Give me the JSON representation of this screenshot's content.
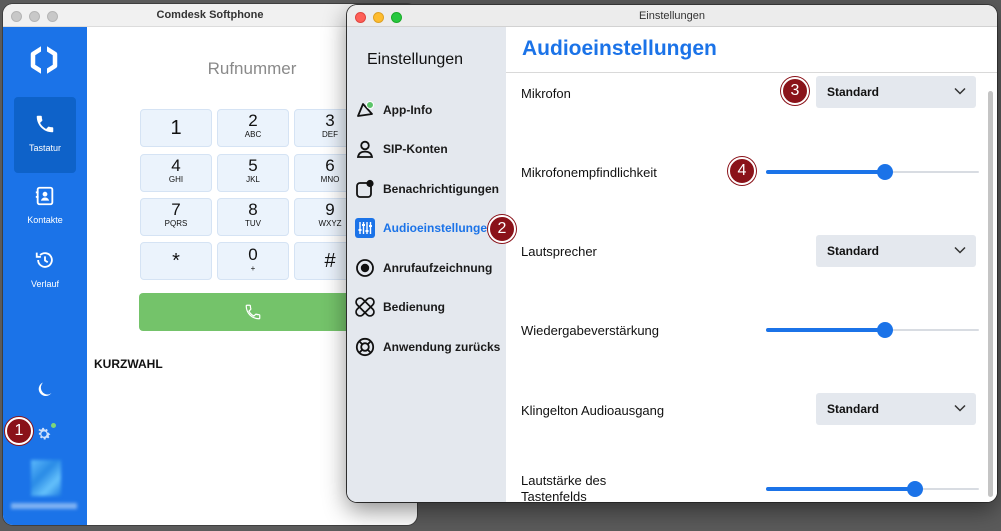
{
  "softphone": {
    "window_title": "Comdesk Softphone",
    "nav": [
      {
        "label": "Tastatur",
        "icon": "phone-icon"
      },
      {
        "label": "Kontakte",
        "icon": "contacts-icon"
      },
      {
        "label": "Verlauf",
        "icon": "history-icon"
      }
    ],
    "dial_title": "Rufnummer",
    "keys": [
      {
        "digit": "1",
        "letters": ""
      },
      {
        "digit": "2",
        "letters": "ABC"
      },
      {
        "digit": "3",
        "letters": "DEF"
      },
      {
        "digit": "4",
        "letters": "GHI"
      },
      {
        "digit": "5",
        "letters": "JKL"
      },
      {
        "digit": "6",
        "letters": "MNO"
      },
      {
        "digit": "7",
        "letters": "PQRS"
      },
      {
        "digit": "8",
        "letters": "TUV"
      },
      {
        "digit": "9",
        "letters": "WXYZ"
      },
      {
        "digit": "*",
        "letters": ""
      },
      {
        "digit": "0",
        "letters": "+"
      },
      {
        "digit": "#",
        "letters": ""
      }
    ],
    "speed_dial_label": "KURZWAHL"
  },
  "settings": {
    "window_title": "Einstellungen",
    "sidebar_title": "Einstellungen",
    "sidebar_items": [
      {
        "label": "App-Info",
        "icon": "app-info-icon"
      },
      {
        "label": "SIP-Konten",
        "icon": "user-icon"
      },
      {
        "label": "Benachrichtigungen",
        "icon": "notification-icon"
      },
      {
        "label": "Audioeinstellungen",
        "icon": "sliders-icon",
        "active": true
      },
      {
        "label": "Anrufaufzeichnung",
        "icon": "record-icon"
      },
      {
        "label": "Bedienung",
        "icon": "bandage-icon"
      },
      {
        "label": "Anwendung zurücks",
        "icon": "lifebuoy-icon"
      }
    ],
    "page_title": "Audioeinstellungen",
    "rows": {
      "mikrofon": {
        "label": "Mikrofon",
        "value": "Standard"
      },
      "empfindlichkeit": {
        "label": "Mikrofonempfindlichkeit",
        "level": 0.56
      },
      "lautsprecher": {
        "label": "Lautsprecher",
        "value": "Standard"
      },
      "verstaerkung": {
        "label": "Wiedergabeverstärkung",
        "level": 0.56
      },
      "klingelton": {
        "label": "Klingelton Audioausgang",
        "value": "Standard"
      },
      "tastenfeld": {
        "label_line1": "Lautstärke des",
        "label_line2": "Tastenfelds",
        "level": 0.7
      }
    }
  },
  "markers": [
    "1",
    "2",
    "3",
    "4"
  ],
  "colors": {
    "accent": "#1b73e8",
    "call_green": "#74c36a",
    "marker": "#8a1219"
  }
}
